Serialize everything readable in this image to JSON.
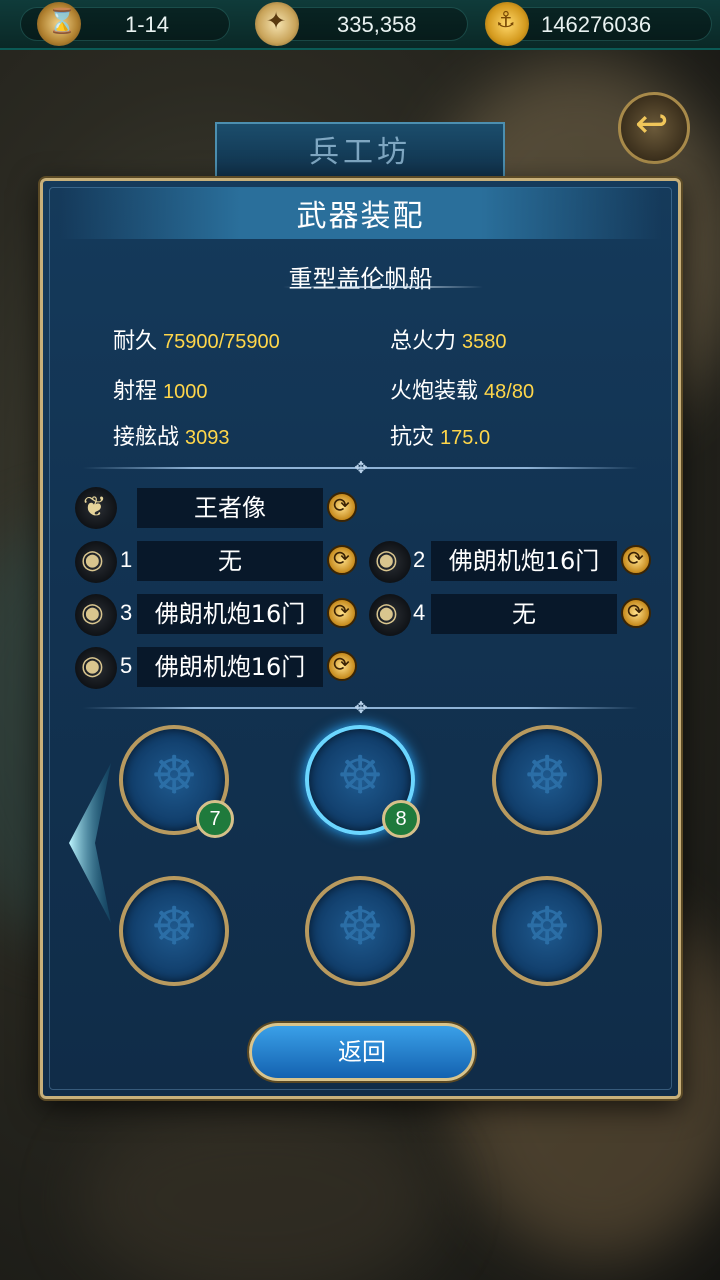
{
  "top_bar": {
    "stage": "1-14",
    "silver": "335,358",
    "gold": "146276036"
  },
  "background": {
    "workshop_title": "兵工坊"
  },
  "panel": {
    "title": "武器装配",
    "ship_name": "重型盖伦帆船",
    "stats": {
      "durability_label": "耐久",
      "durability_value": "75900/75900",
      "total_firepower_label": "总火力",
      "total_firepower_value": "3580",
      "range_label": "射程",
      "range_value": "1000",
      "cannon_load_label": "火炮装载",
      "cannon_load_value": "48/80",
      "boarding_label": "接舷战",
      "boarding_value": "3093",
      "disaster_resist_label": "抗灾",
      "disaster_resist_value": "175.0"
    },
    "figurehead": {
      "label": "王者像"
    },
    "cannon_slots": [
      {
        "num": "1",
        "label": "无"
      },
      {
        "num": "2",
        "label": "佛朗机炮16门"
      },
      {
        "num": "3",
        "label": "佛朗机炮16门"
      },
      {
        "num": "4",
        "label": "无"
      },
      {
        "num": "5",
        "label": "佛朗机炮16门"
      }
    ],
    "crew_badges": [
      "7",
      "8"
    ],
    "return_label": "返回"
  },
  "colors": {
    "value_yellow": "#ffd64a",
    "panel_blue": "#123352",
    "frame_gold": "#c8b07a"
  }
}
